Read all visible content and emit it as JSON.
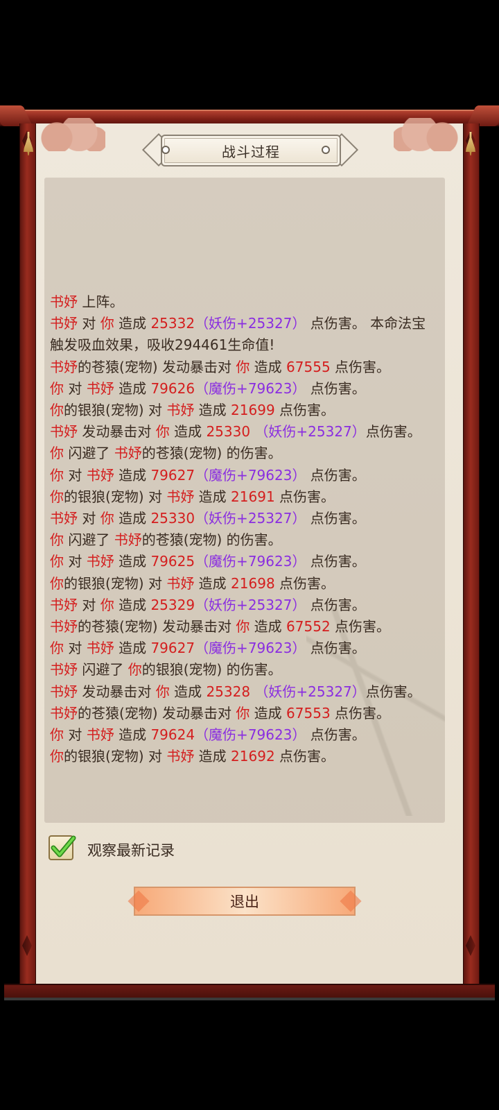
{
  "title": "战斗过程",
  "log": [
    [
      [
        "r",
        "书妤"
      ],
      [
        "n",
        " 上阵。"
      ]
    ],
    [
      [
        "r",
        "书妤"
      ],
      [
        "n",
        " 对 "
      ],
      [
        "r",
        "你"
      ],
      [
        "n",
        " 造成 "
      ],
      [
        "r",
        "25332"
      ],
      [
        "p",
        "（妖伤+25327）"
      ],
      [
        "n",
        " 点伤害。 本命法宝触发吸血效果，吸收294461生命值!"
      ]
    ],
    [
      [
        "r",
        "书妤"
      ],
      [
        "n",
        "的苍猿(宠物) 发动暴击对 "
      ],
      [
        "r",
        "你"
      ],
      [
        "n",
        " 造成 "
      ],
      [
        "r",
        "67555"
      ],
      [
        "n",
        " 点伤害。"
      ]
    ],
    [
      [
        "r",
        "你"
      ],
      [
        "n",
        " 对 "
      ],
      [
        "r",
        "书妤"
      ],
      [
        "n",
        " 造成 "
      ],
      [
        "r",
        "79626"
      ],
      [
        "p",
        "（魔伤+79623）"
      ],
      [
        "n",
        " 点伤害。"
      ]
    ],
    [
      [
        "r",
        "你"
      ],
      [
        "n",
        "的银狼(宠物) 对 "
      ],
      [
        "r",
        "书妤"
      ],
      [
        "n",
        " 造成 "
      ],
      [
        "r",
        "21699"
      ],
      [
        "n",
        " 点伤害。"
      ]
    ],
    [
      [
        "r",
        "书妤"
      ],
      [
        "n",
        " 发动暴击对 "
      ],
      [
        "r",
        "你"
      ],
      [
        "n",
        " 造成 "
      ],
      [
        "r",
        "25330"
      ],
      [
        "p",
        " （妖伤+25327）"
      ],
      [
        "n",
        "点伤害。"
      ]
    ],
    [
      [
        "r",
        "你"
      ],
      [
        "n",
        " 闪避了 "
      ],
      [
        "r",
        "书妤"
      ],
      [
        "n",
        "的苍猿(宠物) 的伤害。"
      ]
    ],
    [
      [
        "r",
        "你"
      ],
      [
        "n",
        " 对 "
      ],
      [
        "r",
        "书妤"
      ],
      [
        "n",
        " 造成 "
      ],
      [
        "r",
        "79627"
      ],
      [
        "p",
        "（魔伤+79623）"
      ],
      [
        "n",
        " 点伤害。"
      ]
    ],
    [
      [
        "r",
        "你"
      ],
      [
        "n",
        "的银狼(宠物) 对 "
      ],
      [
        "r",
        "书妤"
      ],
      [
        "n",
        " 造成 "
      ],
      [
        "r",
        "21691"
      ],
      [
        "n",
        " 点伤害。"
      ]
    ],
    [
      [
        "r",
        "书妤"
      ],
      [
        "n",
        " 对 "
      ],
      [
        "r",
        "你"
      ],
      [
        "n",
        " 造成 "
      ],
      [
        "r",
        "25330"
      ],
      [
        "p",
        "（妖伤+25327）"
      ],
      [
        "n",
        " 点伤害。"
      ]
    ],
    [
      [
        "r",
        "你"
      ],
      [
        "n",
        " 闪避了 "
      ],
      [
        "r",
        "书妤"
      ],
      [
        "n",
        "的苍猿(宠物) 的伤害。"
      ]
    ],
    [
      [
        "r",
        "你"
      ],
      [
        "n",
        " 对 "
      ],
      [
        "r",
        "书妤"
      ],
      [
        "n",
        " 造成 "
      ],
      [
        "r",
        "79625"
      ],
      [
        "p",
        "（魔伤+79623）"
      ],
      [
        "n",
        " 点伤害。"
      ]
    ],
    [
      [
        "r",
        "你"
      ],
      [
        "n",
        "的银狼(宠物) 对 "
      ],
      [
        "r",
        "书妤"
      ],
      [
        "n",
        " 造成 "
      ],
      [
        "r",
        "21698"
      ],
      [
        "n",
        " 点伤害。"
      ]
    ],
    [
      [
        "r",
        "书妤"
      ],
      [
        "n",
        " 对 "
      ],
      [
        "r",
        "你"
      ],
      [
        "n",
        " 造成 "
      ],
      [
        "r",
        "25329"
      ],
      [
        "p",
        "（妖伤+25327）"
      ],
      [
        "n",
        " 点伤害。"
      ]
    ],
    [
      [
        "r",
        "书妤"
      ],
      [
        "n",
        "的苍猿(宠物) 发动暴击对 "
      ],
      [
        "r",
        "你"
      ],
      [
        "n",
        " 造成 "
      ],
      [
        "r",
        "67552"
      ],
      [
        "n",
        " 点伤害。"
      ]
    ],
    [
      [
        "r",
        "你"
      ],
      [
        "n",
        " 对 "
      ],
      [
        "r",
        "书妤"
      ],
      [
        "n",
        " 造成 "
      ],
      [
        "r",
        "79627"
      ],
      [
        "p",
        "（魔伤+79623）"
      ],
      [
        "n",
        " 点伤害。"
      ]
    ],
    [
      [
        "r",
        "书妤"
      ],
      [
        "n",
        " 闪避了 "
      ],
      [
        "r",
        "你"
      ],
      [
        "n",
        "的银狼(宠物) 的伤害。"
      ]
    ],
    [
      [
        "r",
        "书妤"
      ],
      [
        "n",
        " 发动暴击对 "
      ],
      [
        "r",
        "你"
      ],
      [
        "n",
        " 造成 "
      ],
      [
        "r",
        "25328"
      ],
      [
        "p",
        " （妖伤+25327）"
      ],
      [
        "n",
        "点伤害。"
      ]
    ],
    [
      [
        "r",
        "书妤"
      ],
      [
        "n",
        "的苍猿(宠物) 发动暴击对 "
      ],
      [
        "r",
        "你"
      ],
      [
        "n",
        " 造成 "
      ],
      [
        "r",
        "67553"
      ],
      [
        "n",
        " 点伤害。"
      ]
    ],
    [
      [
        "r",
        "你"
      ],
      [
        "n",
        " 对 "
      ],
      [
        "r",
        "书妤"
      ],
      [
        "n",
        " 造成 "
      ],
      [
        "r",
        "79624"
      ],
      [
        "p",
        "（魔伤+79623）"
      ],
      [
        "n",
        " 点伤害。"
      ]
    ],
    [
      [
        "r",
        "你"
      ],
      [
        "n",
        "的银狼(宠物) 对 "
      ],
      [
        "r",
        "书妤"
      ],
      [
        "n",
        " 造成 "
      ],
      [
        "r",
        "21692"
      ],
      [
        "n",
        " 点伤害。"
      ]
    ]
  ],
  "checkbox": {
    "label": "观察最新记录",
    "checked": true
  },
  "exit_button": "退出",
  "colors": {
    "name": "#d41e1e",
    "damage_type": "#8a2ee0",
    "text": "#3a2c22",
    "frame": "#7c1f16"
  }
}
